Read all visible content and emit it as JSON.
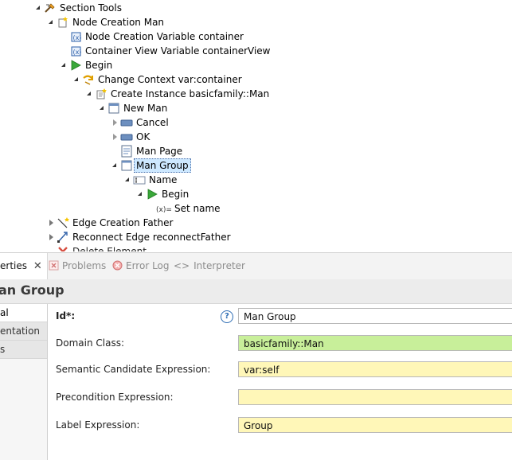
{
  "tree": {
    "section_tools": "Section Tools",
    "node_creation_man": "Node Creation Man",
    "node_creation_variable": "Node Creation Variable container",
    "container_view_variable": "Container View Variable containerView",
    "begin": "Begin",
    "change_context": "Change Context var:container",
    "create_instance": "Create Instance basicfamily::Man",
    "new_man": "New Man",
    "cancel": "Cancel",
    "ok": "OK",
    "man_page": "Man Page",
    "man_group": "Man Group",
    "name": "Name",
    "begin2": "Begin",
    "set_name": "Set name",
    "edge_creation_father": "Edge Creation Father",
    "reconnect_edge": "Reconnect Edge reconnectFather",
    "cut_off": "Delete Element ..."
  },
  "tabs": {
    "properties": "erties",
    "problems": "Problems",
    "error_log": "Error Log",
    "interpreter": "Interpreter"
  },
  "title": "an Group",
  "sidebar": [
    "al",
    "entation",
    "s"
  ],
  "form": {
    "id_label": "Id*:",
    "id_value": "Man Group",
    "domain_class_label": "Domain Class:",
    "domain_class_value": "basicfamily::Man",
    "semantic_label": "Semantic Candidate Expression:",
    "semantic_value": "var:self",
    "precondition_label": "Precondition Expression:",
    "precondition_value": "",
    "label_expr_label": "Label Expression:",
    "label_expr_value": "Group",
    "help_glyph": "?"
  },
  "colors": {
    "selection": "#cde8ff",
    "green_field": "#c8ef9a",
    "yellow_field": "#fff7b8",
    "begin_green": "#3aa83a"
  }
}
